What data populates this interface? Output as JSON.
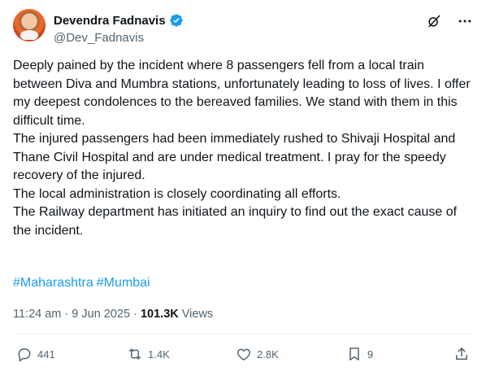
{
  "author": {
    "name": "Devendra Fadnavis",
    "handle": "@Dev_Fadnavis"
  },
  "header_icons": [
    "grok-icon",
    "more-icon"
  ],
  "body": {
    "paragraphs": [
      "Deeply pained by the incident where 8 passengers fell from a local train between Diva and Mumbra stations, unfortunately leading to loss of lives. I offer my deepest condolences to the bereaved families. We stand with them in this difficult time.",
      "The injured passengers had been immediately rushed to Shivaji Hospital and Thane Civil Hospital and are under medical treatment. I pray for the speedy recovery of the injured.",
      "The local administration is closely coordinating all efforts.",
      "The Railway department has initiated an inquiry to find out the exact cause of the incident."
    ],
    "hashtags": [
      "#Maharashtra",
      "#Mumbai"
    ]
  },
  "meta": {
    "time": "11:24 am",
    "separator": "·",
    "date": "9 Jun 2025",
    "views_count": "101.3K",
    "views_label": "Views"
  },
  "actions": {
    "replies": "441",
    "reposts": "1.4K",
    "likes": "2.8K",
    "bookmarks": "9"
  },
  "colors": {
    "accent": "#1d9bf0",
    "text": "#0f1419",
    "secondary": "#536471"
  }
}
